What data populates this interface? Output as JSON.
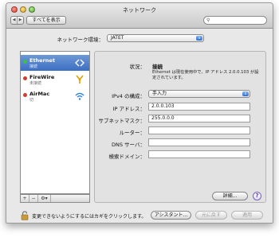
{
  "window": {
    "title": "ネットワーク"
  },
  "toolbar": {
    "back": "◀",
    "forward": "▶",
    "show_all": "すべてを表示",
    "search_placeholder": ""
  },
  "environment": {
    "label": "ネットワーク環境：",
    "value": "JATET"
  },
  "services": [
    {
      "name": "Ethernet",
      "status": "接続",
      "dot_color": "#3cc23c",
      "selected": true,
      "icon": "arrows-icon"
    },
    {
      "name": "FireWire",
      "status": "未接続",
      "dot_color": "#d63a2f",
      "selected": false,
      "icon": "firewire-icon"
    },
    {
      "name": "AirMac",
      "status": "切",
      "dot_color": "#d63a2f",
      "selected": false,
      "icon": "wifi-icon"
    }
  ],
  "sidebar_actions": {
    "add": "+",
    "remove": "−",
    "gear": "⚙▾"
  },
  "details": {
    "status_label": "状況：",
    "status_value": "接続",
    "status_description": "Ethernet は現在使用中で、IP アドレス 2.0.0.103 が設定されています。",
    "ipv4_label": "IPv4 の構成：",
    "ipv4_value": "手入力",
    "ip_label": "IP アドレス：",
    "ip_value": "2.0.0.103",
    "subnet_label": "サブネットマスク：",
    "subnet_value": "255.0.0.0",
    "router_label": "ルーター：",
    "router_value": "",
    "dns_label": "DNS サーバ：",
    "dns_value": "",
    "search_domain_label": "検索ドメイン：",
    "search_domain_value": "",
    "advanced_button": "詳細...",
    "help": "?"
  },
  "footer": {
    "lock_text": "変更できないようにするにはカギをクリックします。",
    "assistant_button": "アシスタント...",
    "revert_button": "元に戻す",
    "apply_button": "適用"
  }
}
